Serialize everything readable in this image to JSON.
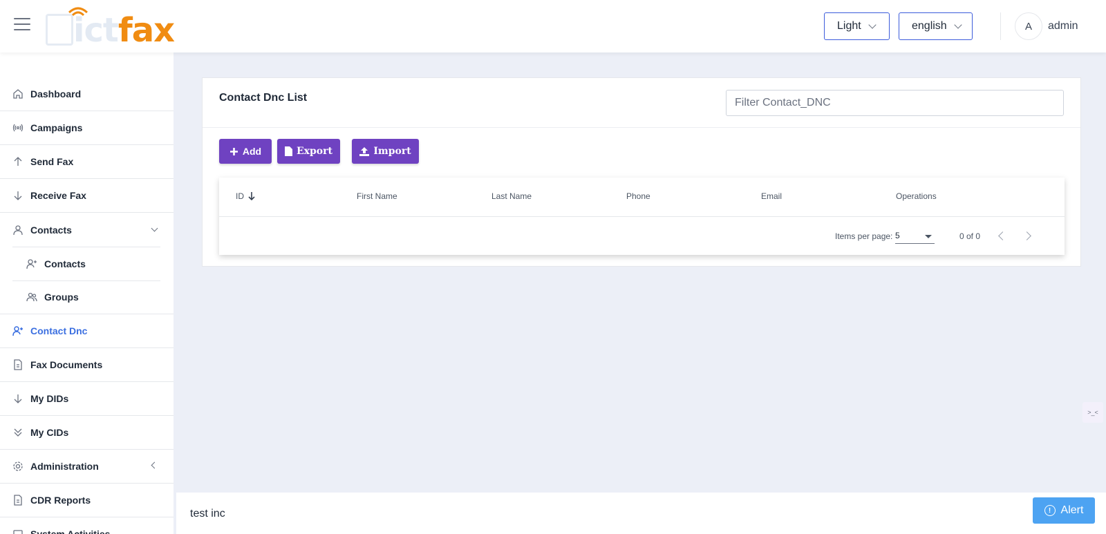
{
  "header": {
    "logo_text_ghost": "ict",
    "logo_text": "fax",
    "theme": "Light",
    "language": "english",
    "avatar_initial": "A",
    "username": "admin"
  },
  "sidebar": {
    "items": [
      {
        "label": "Dashboard",
        "icon": "home-icon"
      },
      {
        "label": "Campaigns",
        "icon": "broadcast-icon"
      },
      {
        "label": "Send Fax",
        "icon": "arrow-up-icon"
      },
      {
        "label": "Receive Fax",
        "icon": "arrow-down-icon"
      },
      {
        "label": "Contacts",
        "icon": "user-icon"
      },
      {
        "label": "Contacts",
        "icon": "user-plus-icon"
      },
      {
        "label": "Groups",
        "icon": "users-icon"
      },
      {
        "label": "Contact Dnc",
        "icon": "user-plus-icon"
      },
      {
        "label": "Fax Documents",
        "icon": "document-icon"
      },
      {
        "label": "My DIDs",
        "icon": "arrow-down-icon"
      },
      {
        "label": "My CIDs",
        "icon": "double-chevron-down-icon"
      },
      {
        "label": "Administration",
        "icon": "gear-icon"
      },
      {
        "label": "CDR Reports",
        "icon": "document-icon"
      },
      {
        "label": "System Activities",
        "icon": "square-icon"
      }
    ]
  },
  "main": {
    "title": "Contact Dnc List",
    "filter_placeholder": "Filter Contact_DNC",
    "buttons": {
      "add": "Add",
      "export": "Export",
      "import": "Import"
    },
    "table": {
      "columns": [
        "ID",
        "First Name",
        "Last Name",
        "Phone",
        "Email",
        "Operations"
      ],
      "rows": []
    },
    "paginator": {
      "items_per_page_label": "Items per page:",
      "page_size": "5",
      "range": "0 of 0"
    }
  },
  "footer": {
    "text": "test inc",
    "alert_label": "Alert"
  },
  "colors": {
    "accent_purple": "#6f42c1",
    "active_blue": "#3b6fe0",
    "logo_orange": "#f08c12",
    "alert_blue": "#4da3f2"
  }
}
